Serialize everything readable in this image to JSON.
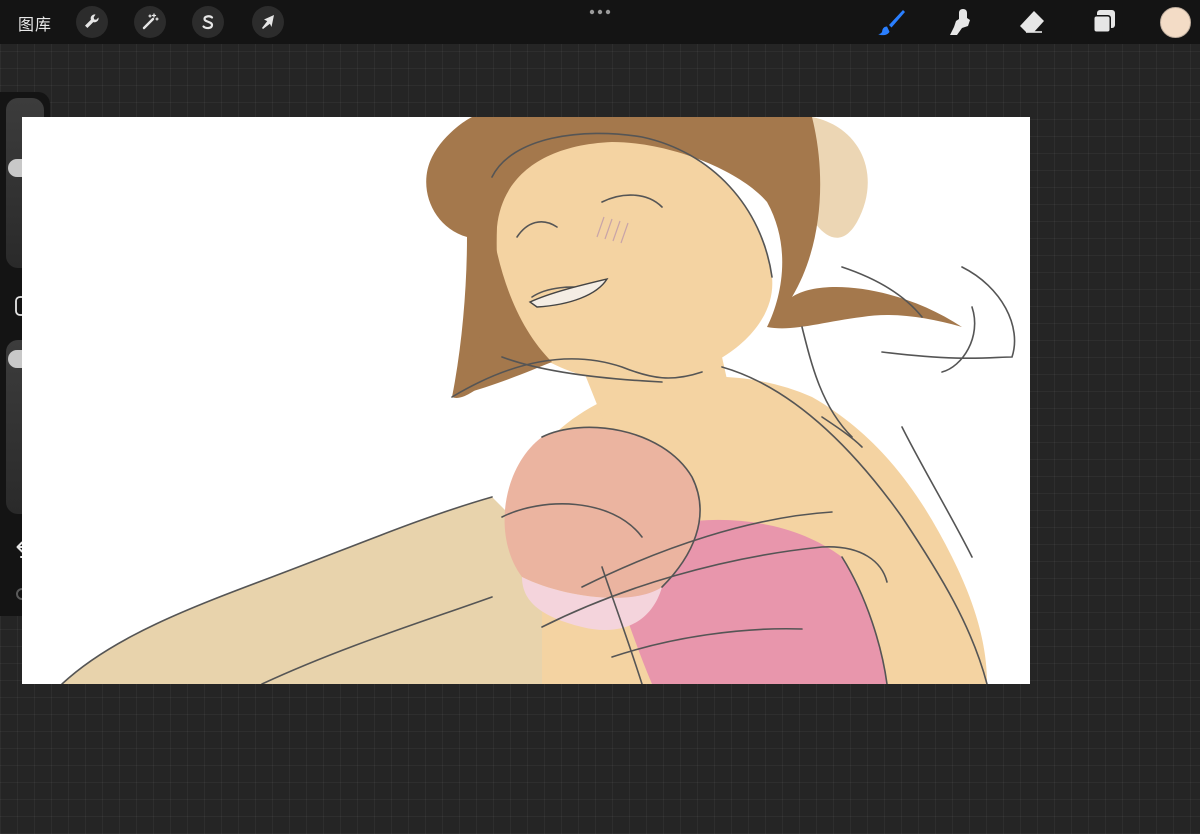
{
  "topbar": {
    "gallery_label": "图库",
    "left_tools": [
      {
        "icon": "wrench-icon",
        "tool": "actions"
      },
      {
        "icon": "magic-wand-icon",
        "tool": "adjustments"
      },
      {
        "icon": "selection-s-icon",
        "tool": "selection"
      },
      {
        "icon": "arrow-cursor-icon",
        "tool": "transform"
      }
    ],
    "more_icon": "more-dots-icon",
    "right_tools": [
      {
        "icon": "brush-icon",
        "tool": "paint",
        "active": true
      },
      {
        "icon": "smudge-icon",
        "tool": "smudge",
        "active": false
      },
      {
        "icon": "eraser-icon",
        "tool": "erase",
        "active": false
      },
      {
        "icon": "layers-icon",
        "tool": "layers",
        "active": false
      }
    ],
    "current_color": "#f3dcc6"
  },
  "sidebar": {
    "brush_size_level": 0.6,
    "opacity_level": 0.95,
    "icons": [
      "modify-square-icon",
      "undo-icon",
      "redo-icon"
    ]
  },
  "colors": {
    "accent": "#2a7fff",
    "skin": "#f4d3a2",
    "arm": "#e8d3ac",
    "hair": "#a4784c",
    "hair_light": "#ecd6b4",
    "dress": "#e896ac",
    "sleeve": "#ebb4a0",
    "sleeve_light": "#f4d4dc"
  }
}
